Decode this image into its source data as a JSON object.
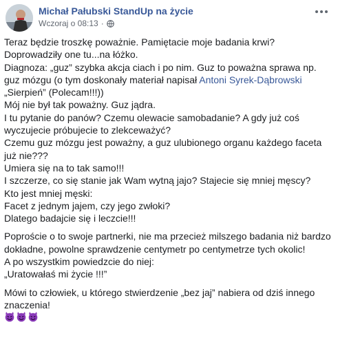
{
  "header": {
    "author": "Michał Pałubski StandUp na życie",
    "time": "Wczoraj o 08:13",
    "separator": "·",
    "privacy_icon": "globe-icon",
    "more_icon": "more-options-icon"
  },
  "post": {
    "p1": {
      "l1": "Teraz będzie troszkę poważnie. Pamiętacie moje badania krwi?",
      "l2": "Doprowadziły one tu...na łóżko.",
      "l3": "Diagnoza: „guz” szybka akcja ciach i po nim. Guz to poważna sprawa np.",
      "l4_before": "guz mózgu (o tym doskonały materiał napisał ",
      "l4_link": "Antoni Syrek-Dąbrowski",
      "l5": "„Sierpień” (Polecam!!!))",
      "l6": "Mój nie był tak poważny. Guz jądra.",
      "l7": "I tu pytanie do panów? Czemu olewacie samobadanie? A gdy już coś",
      "l8": "wyczujecie próbujecie to zlekceważyć?",
      "l9": "Czemu guz mózgu jest poważny, a guz ulubionego organu każdego faceta",
      "l10": "już nie???",
      "l11": "Umiera się na to tak samo!!!",
      "l12": "I szczerze, co się stanie jak Wam wytną jajo? Stajecie się mniej męscy?",
      "l13": "Kto jest mniej męski:",
      "l14": "Facet z jednym jajem, czy jego zwłoki?",
      "l15": "Dlatego badajcie się i leczcie!!!"
    },
    "p2": {
      "l1": "Poproście o to swoje partnerki, nie ma przecież milszego badania niż bardzo",
      "l2": "dokładne, powolne sprawdzenie centymetr po centymetrze tych okolic!",
      "l3": "A po wszystkim powiedzcie do niej:",
      "l4": "„Uratowałaś mi życie !!!”"
    },
    "p3": {
      "l1": "Mówi to człowiek, u którego stwierdzenie „bez jaj” nabiera od dziś innego",
      "l2": "znaczenia!"
    },
    "emojis": [
      "smiling-devil-emoji",
      "smiling-devil-emoji",
      "smiling-devil-emoji"
    ]
  },
  "colors": {
    "link": "#385898",
    "text": "#1c1e21",
    "meta": "#616770",
    "emoji": "#8a3ab9"
  }
}
